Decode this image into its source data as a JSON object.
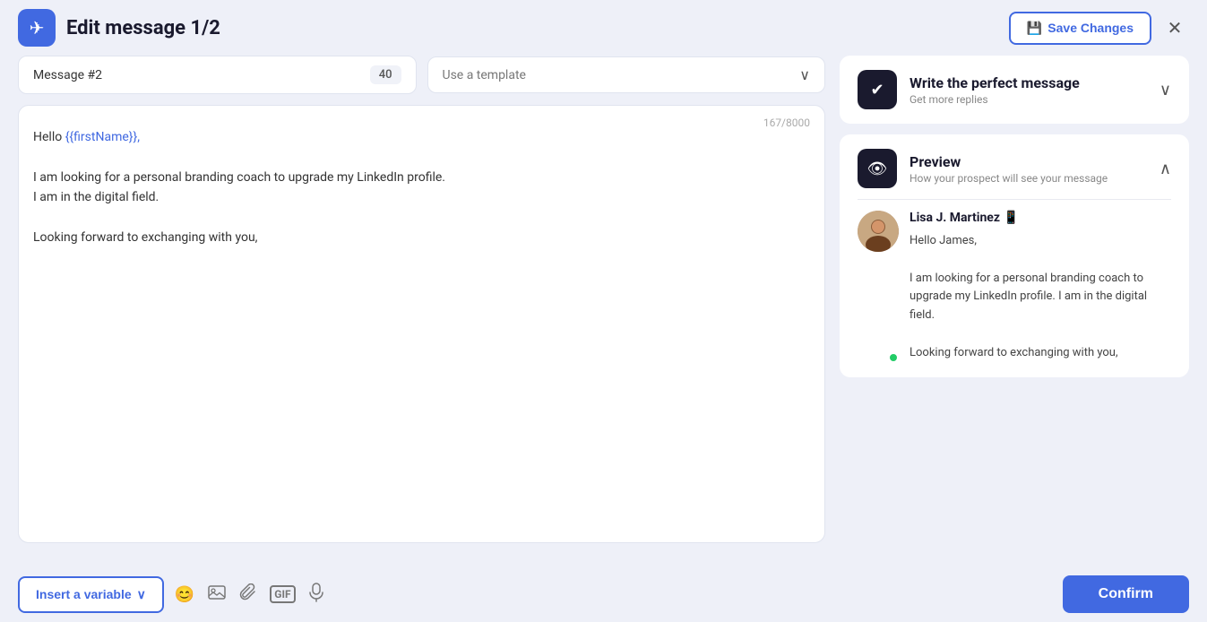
{
  "header": {
    "logo_icon": "✈",
    "title": "Edit message 1/2",
    "save_changes_label": "Save Changes",
    "save_icon": "💾",
    "close_icon": "✕"
  },
  "controls": {
    "message_label": "Message #2",
    "char_count": "40",
    "template_placeholder": "Use a template",
    "chevron": "∨"
  },
  "message_editor": {
    "char_counter": "167/8000",
    "line1_prefix": "Hello ",
    "line1_variable": "{{firstName}},",
    "line2": "I am looking for a personal branding coach to upgrade my LinkedIn profile.",
    "line3": "I am in the digital field.",
    "line4": "",
    "line5": "Looking forward to exchanging with you,"
  },
  "toolbar": {
    "insert_variable_label": "Insert a variable",
    "chevron": "∨",
    "emoji_icon": "😊",
    "image_icon": "🖼",
    "attachment_icon": "📎",
    "gif_icon": "GIF",
    "mic_icon": "🎤",
    "confirm_label": "Confirm"
  },
  "right_panel": {
    "write_message": {
      "icon": "✔",
      "title": "Write the perfect message",
      "subtitle": "Get more replies",
      "collapse_icon": "∨"
    },
    "preview": {
      "icon": "👁",
      "title": "Preview",
      "subtitle": "How your prospect will see your message",
      "collapse_icon": "∧",
      "sender_name": "Lisa J. Martinez 📱",
      "preview_line1": "Hello James,",
      "preview_line2": "I am looking for a personal branding coach to upgrade my LinkedIn profile. I am in the digital field.",
      "preview_line3": "Looking forward to exchanging with you,"
    }
  }
}
